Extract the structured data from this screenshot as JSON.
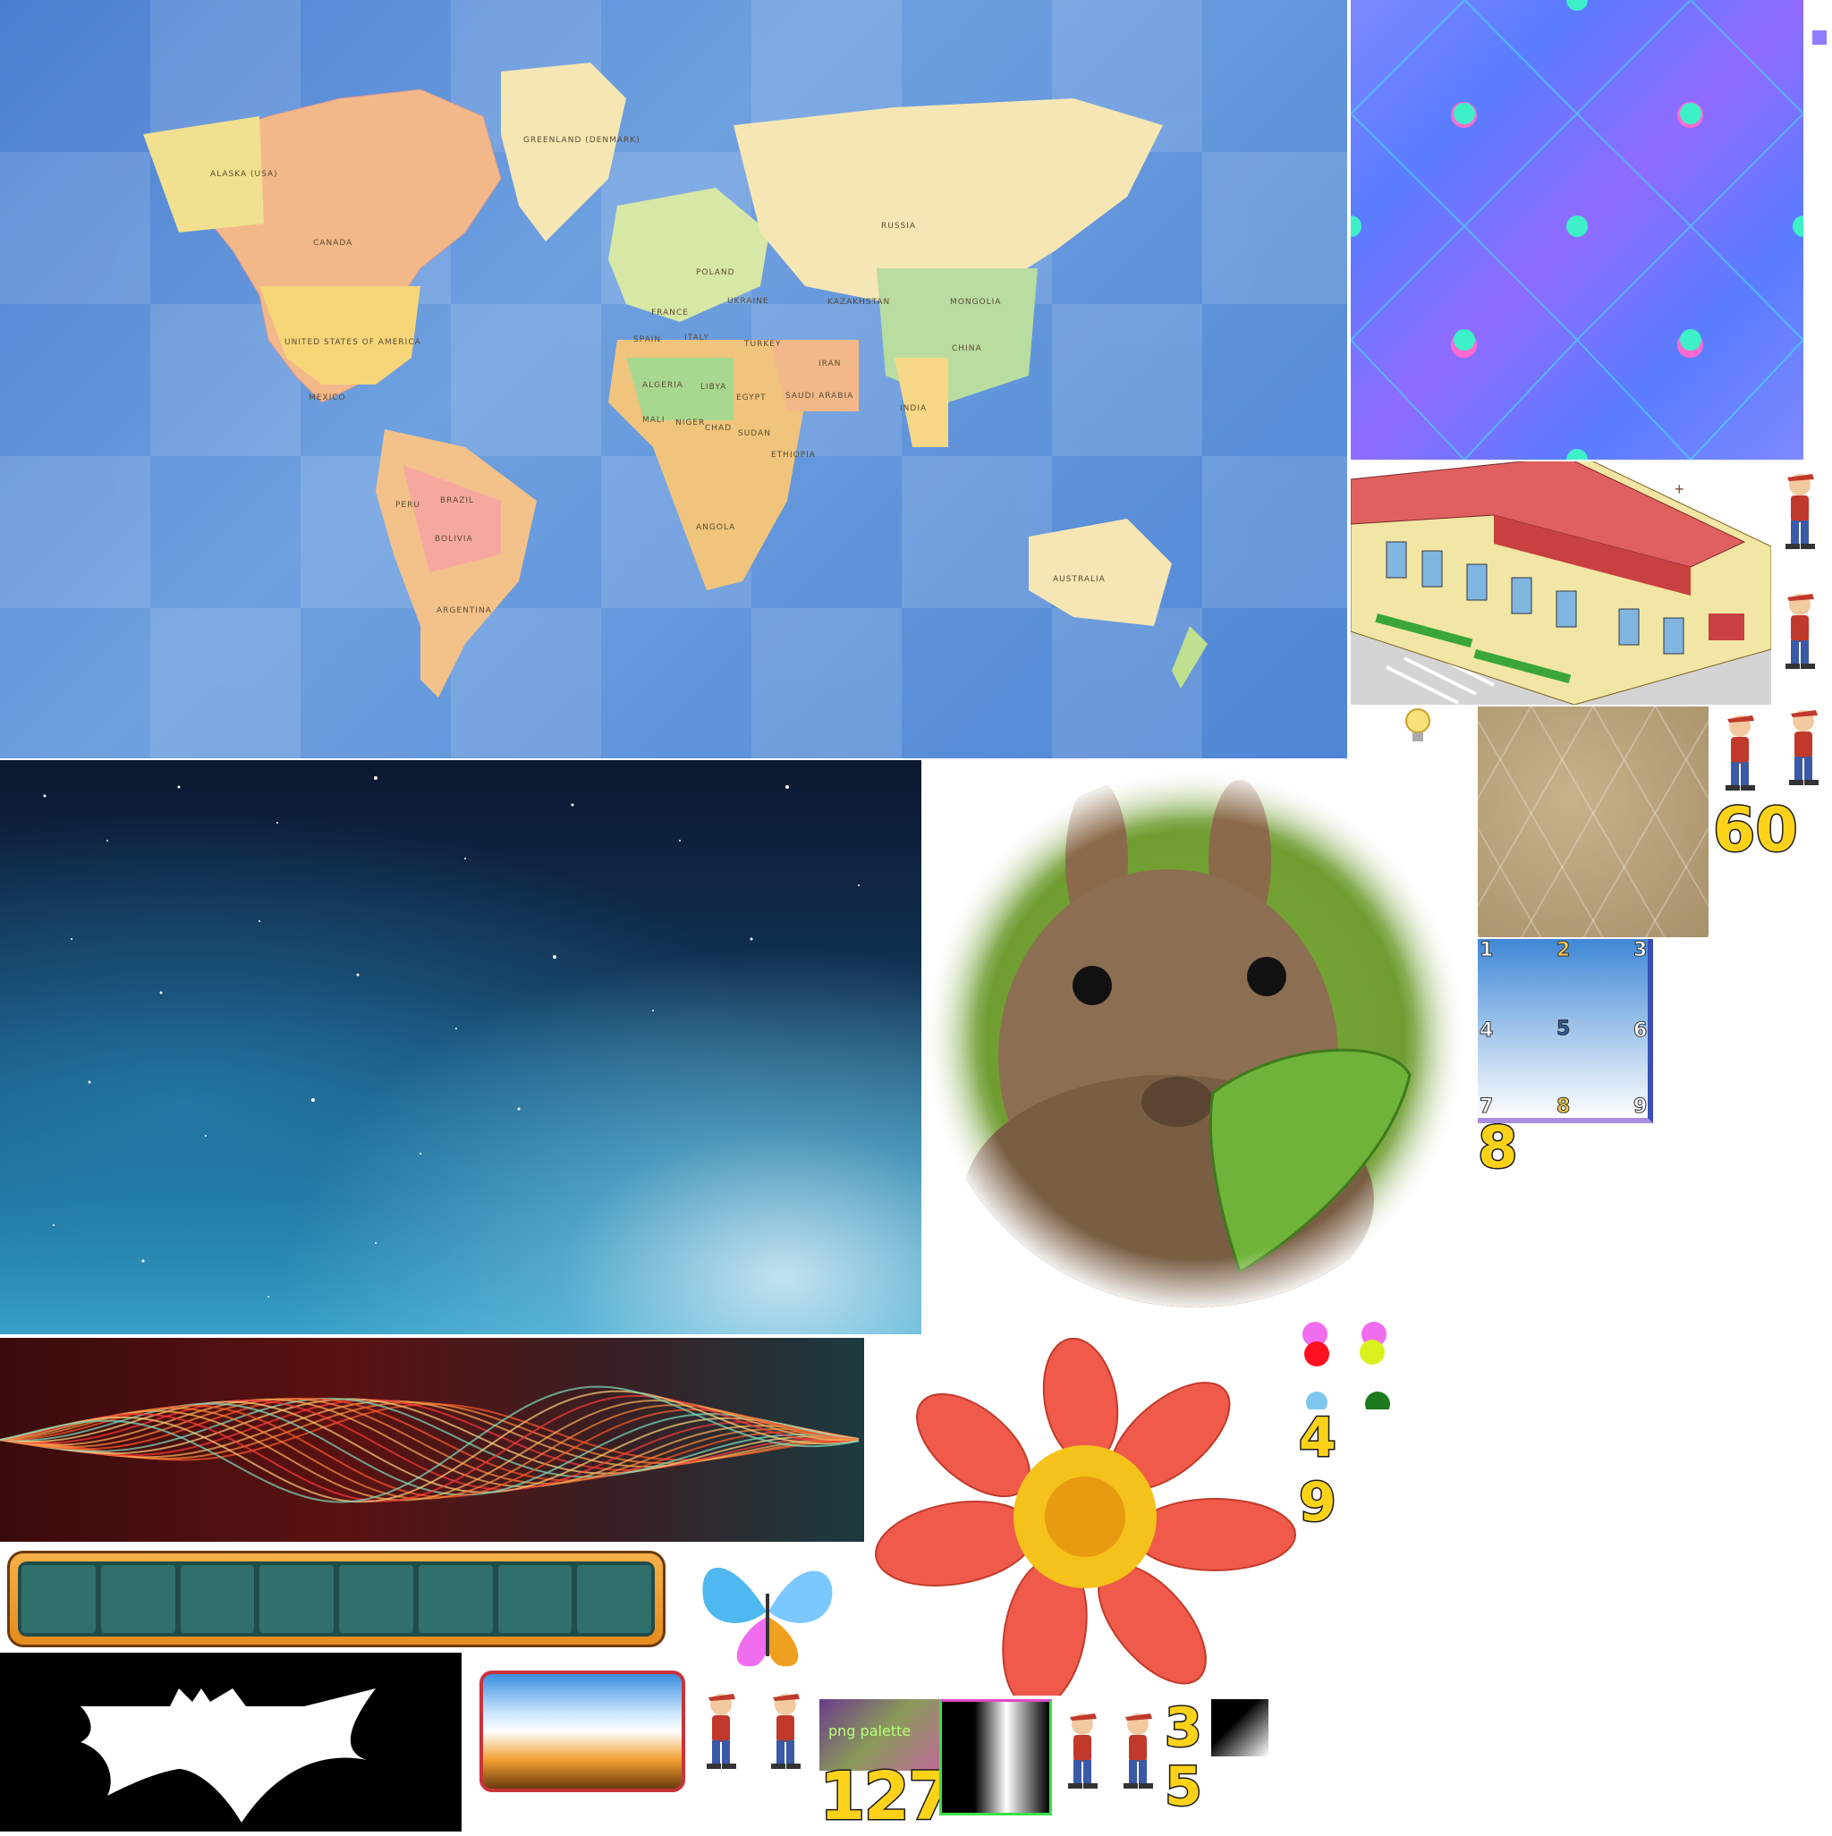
{
  "atlas": {
    "world_map": {
      "labels": [
        "ALASKA (USA)",
        "CANADA",
        "UNITED STATES OF AMERICA",
        "MEXICO",
        "GREENLAND (DENMARK)",
        "RUSSIA",
        "KAZAKHSTAN",
        "MONGOLIA",
        "CHINA",
        "INDIA",
        "IRAN",
        "SAUDI ARABIA",
        "TURKEY",
        "UKRAINE",
        "SPAIN",
        "ITALY",
        "ALGERIA",
        "LIBYA",
        "EGYPT",
        "MALI",
        "NIGER",
        "CHAD",
        "SUDAN",
        "ETHIOPIA",
        "ANGOLA",
        "BRAZIL",
        "PERU",
        "BOLIVIA",
        "ARGENTINA",
        "AUSTRALIA",
        "FRANCE",
        "POLAND"
      ]
    },
    "palette_label": "png palette",
    "counters": {
      "n60": "60",
      "n8": "8",
      "n4": "4",
      "n9": "9",
      "n127": "127",
      "n3": "3",
      "n5": "5"
    },
    "grid_numbers": [
      "1",
      "2",
      "3",
      "4",
      "5",
      "6",
      "7",
      "8",
      "9"
    ],
    "colors": {
      "ocean": "#5b8fd6",
      "land": "#f5e6b4",
      "roof": "#d94a4a",
      "progress_frame": "#f2a134",
      "progress_cell": "#2f6f6c"
    },
    "icons": [
      "lightbulb-icon",
      "bat-logo-icon",
      "butterfly-icon",
      "crosshair-icon"
    ]
  }
}
